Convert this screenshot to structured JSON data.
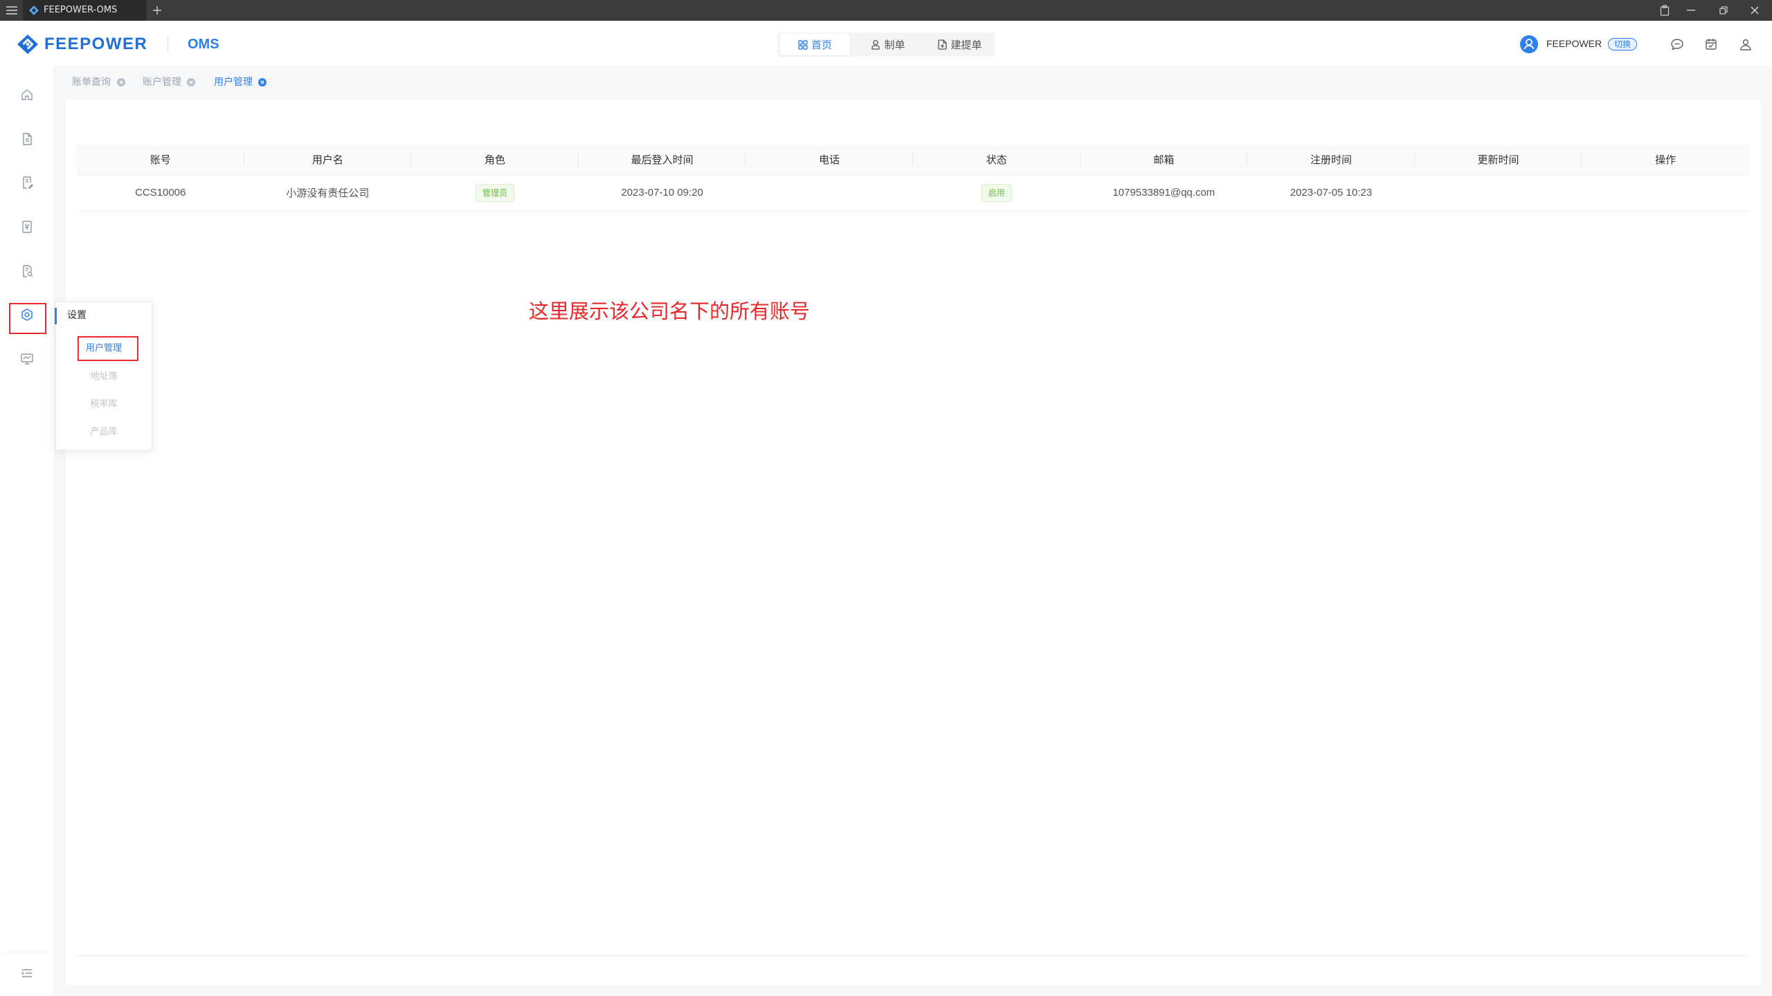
{
  "window": {
    "tab_title": "FEEPOWER-OMS",
    "icons": [
      "hamburger-menu-icon",
      "app-favicon-icon",
      "new-tab-icon",
      "clipboard-icon",
      "minimize-icon",
      "restore-icon",
      "close-icon"
    ]
  },
  "header": {
    "brand": "FEEPOWER",
    "product": "OMS",
    "nav": [
      {
        "label": "首页",
        "icon": "grid-icon",
        "active": true
      },
      {
        "label": "制单",
        "icon": "user-form-icon",
        "active": false
      },
      {
        "label": "建提单",
        "icon": "doc-plus-icon",
        "active": false
      }
    ],
    "user_name": "FEEPOWER",
    "switch_label": "切换",
    "right_icons": [
      "message-icon",
      "calendar-check-icon",
      "user-icon"
    ]
  },
  "sidebar": {
    "items": [
      {
        "icon": "home-icon",
        "active": false
      },
      {
        "icon": "document-icon",
        "active": false
      },
      {
        "icon": "form-edit-icon",
        "active": false
      },
      {
        "icon": "invoice-icon",
        "active": false
      },
      {
        "icon": "doc-search-icon",
        "active": false
      },
      {
        "icon": "settings-icon",
        "active": true
      },
      {
        "icon": "monitor-chart-icon",
        "active": false
      }
    ],
    "collapse_icon": "menu-fold-icon"
  },
  "page_tabs": [
    {
      "label": "账单查询",
      "active": false
    },
    {
      "label": "账户管理",
      "active": false
    },
    {
      "label": "用户管理",
      "active": true
    }
  ],
  "table": {
    "columns": [
      "账号",
      "用户名",
      "角色",
      "最后登入时间",
      "电话",
      "状态",
      "邮箱",
      "注册时间",
      "更新时间",
      "操作"
    ],
    "rows": [
      {
        "account": "CCS10006",
        "username": "小游没有责任公司",
        "role": "管理员",
        "last_login": "2023-07-10 09:20",
        "phone": "",
        "status": "启用",
        "email": "1079533891@qq.com",
        "registered": "2023-07-05 10:23",
        "updated": "",
        "actions": ""
      }
    ]
  },
  "annotation": "这里展示该公司名下的所有账号",
  "settings_menu": {
    "title": "设置",
    "items": [
      {
        "label": "用户管理",
        "active": true
      },
      {
        "label": "地址簿",
        "active": false
      },
      {
        "label": "税率库",
        "active": false
      },
      {
        "label": "产品库",
        "active": false
      }
    ]
  },
  "colors": {
    "accent": "#2f80ed",
    "danger": "#e8282b",
    "success": "#67c23a",
    "brand": "#1f6fd8"
  }
}
